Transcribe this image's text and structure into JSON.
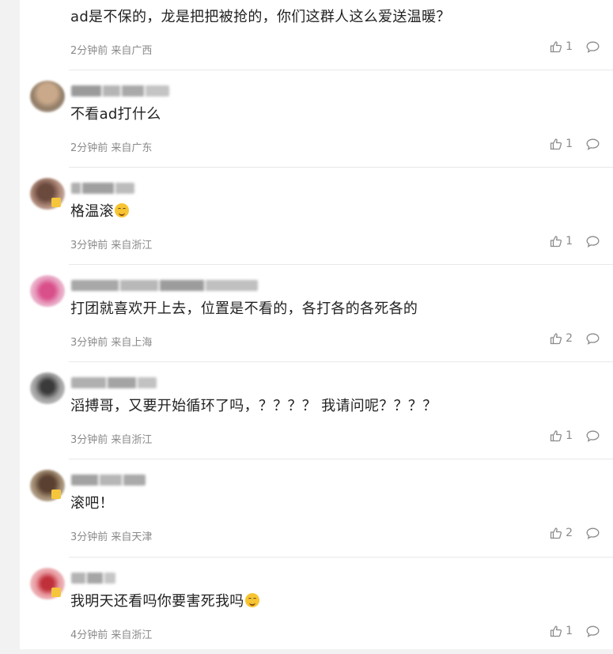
{
  "colors": {
    "page_bg": "#f2f2f2",
    "card_bg": "#ffffff",
    "text": "#222222",
    "meta_text": "#8a8a8a",
    "divider": "#e8e8e8"
  },
  "comments": [
    {
      "text": "ad是不保的，龙是把把被抢的，你们这群人这么爱送温暖？",
      "time": "2分钟前",
      "location": "来自广西",
      "likes": "1",
      "emoji": null,
      "show_user": false
    },
    {
      "text": "不看ad打什么",
      "time": "2分钟前",
      "location": "来自广东",
      "likes": "1",
      "emoji": null,
      "show_user": true
    },
    {
      "text": "格温滚",
      "time": "3分钟前",
      "location": "来自浙江",
      "likes": "1",
      "emoji": "laugh-emoji",
      "show_user": true
    },
    {
      "text": "打团就喜欢开上去，位置是不看的，各打各的各死各的",
      "time": "3分钟前",
      "location": "来自上海",
      "likes": "2",
      "emoji": null,
      "show_user": true
    },
    {
      "text": "滔搏哥，又要开始循环了吗，？？？？ 我请问呢？？？？",
      "time": "3分钟前",
      "location": "来自浙江",
      "likes": "1",
      "emoji": null,
      "show_user": true
    },
    {
      "text": "滚吧！",
      "time": "3分钟前",
      "location": "来自天津",
      "likes": "2",
      "emoji": null,
      "show_user": true
    },
    {
      "text": "我明天还看吗你要害死我吗",
      "time": "4分钟前",
      "location": "来自浙江",
      "likes": "1",
      "emoji": "smile-emoji",
      "show_user": true
    }
  ]
}
